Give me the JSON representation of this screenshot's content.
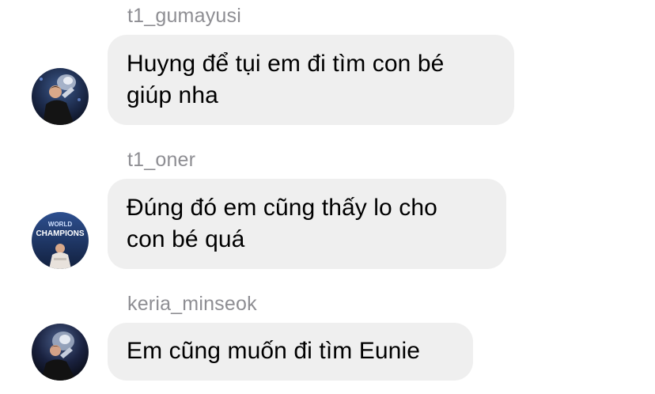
{
  "messages": [
    {
      "sender": "t1_gumayusi",
      "lines": [
        "Huyng để tụi em đi tìm con bé",
        "giúp nha"
      ],
      "avatar_icon": "gumayusi-profile-photo"
    },
    {
      "sender": "t1_oner",
      "lines": [
        "Đúng đó em cũng thấy lo cho",
        "con bé quá"
      ],
      "avatar_icon": "oner-profile-photo",
      "avatar_caption": [
        "WORLD",
        "CHAMPIONS"
      ]
    },
    {
      "sender": "keria_minseok",
      "lines": [
        "Em cũng muốn đi tìm Eunie"
      ],
      "avatar_icon": "keria-profile-photo"
    }
  ],
  "colors": {
    "bubble_bg": "#efefef",
    "sender_text": "#8e8e93",
    "message_text": "#000000",
    "background": "#ffffff"
  }
}
